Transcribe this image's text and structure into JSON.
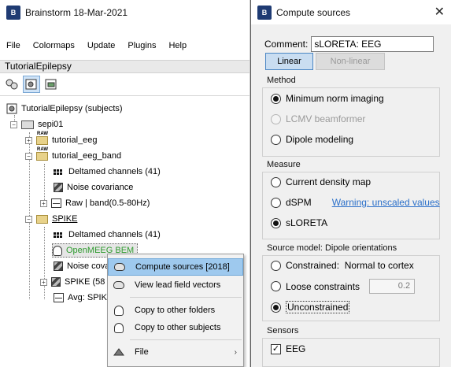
{
  "main_window": {
    "title": "Brainstorm 18-Mar-2021",
    "menu": [
      "File",
      "Colormaps",
      "Update",
      "Plugins",
      "Help"
    ],
    "protocol": "TutorialEpilepsy",
    "tree": {
      "root": "TutorialEpilepsy (subjects)",
      "subject": "sepi01",
      "folders": {
        "tutorial_eeg": "tutorial_eeg",
        "tutorial_eeg_band": "tutorial_eeg_band",
        "spike": "SPIKE"
      },
      "band_items": {
        "channels": "Deltamed channels (41)",
        "noise": "Noise covariance",
        "raw": "Raw | band(0.5-80Hz)"
      },
      "spike_items": {
        "channels": "Deltamed channels (41)",
        "headmodel": "OpenMEEG BEM",
        "noise": "Noise cova",
        "spike": "SPIKE (58",
        "avg": "Avg: SPIK"
      },
      "raw_tag": "RAW"
    }
  },
  "context_menu": {
    "items": [
      {
        "label": "Compute sources [2018]",
        "icon": "brain-icon"
      },
      {
        "label": "View lead field vectors",
        "icon": "brain-icon"
      },
      {
        "label": "Copy to other folders",
        "icon": "head-icon"
      },
      {
        "label": "Copy to other subjects",
        "icon": "head-icon"
      },
      {
        "label": "File",
        "icon": "file-tools-icon",
        "submenu_arrow": "›"
      }
    ]
  },
  "dialog": {
    "title": "Compute sources",
    "comment_label": "Comment:",
    "comment_value": "sLORETA: EEG",
    "linear_label": "Linear",
    "nonlinear_label": "Non-linear",
    "method": {
      "label": "Method",
      "options": [
        "Minimum norm imaging",
        "LCMV beamformer",
        "Dipole modeling"
      ],
      "selected": "Minimum norm imaging"
    },
    "measure": {
      "label": "Measure",
      "options": [
        "Current density map",
        "dSPM",
        "sLORETA"
      ],
      "selected": "sLORETA",
      "warning": "Warning: unscaled values"
    },
    "source_model": {
      "label": "Source model: Dipole orientations",
      "constrained": "Constrained:  Normal to cortex",
      "loose": "Loose constraints",
      "loose_value": "0.2",
      "unconstrained": "Unconstrained",
      "selected": "Unconstrained"
    },
    "sensors": {
      "label": "Sensors",
      "eeg": "EEG",
      "eeg_checked": true
    },
    "close_symbol": "✕"
  },
  "colors": {
    "selection": "#9ec9ee",
    "linear_active": "#c9ddf1",
    "link": "#2a6fc9",
    "green_label": "#2e9a2e"
  }
}
